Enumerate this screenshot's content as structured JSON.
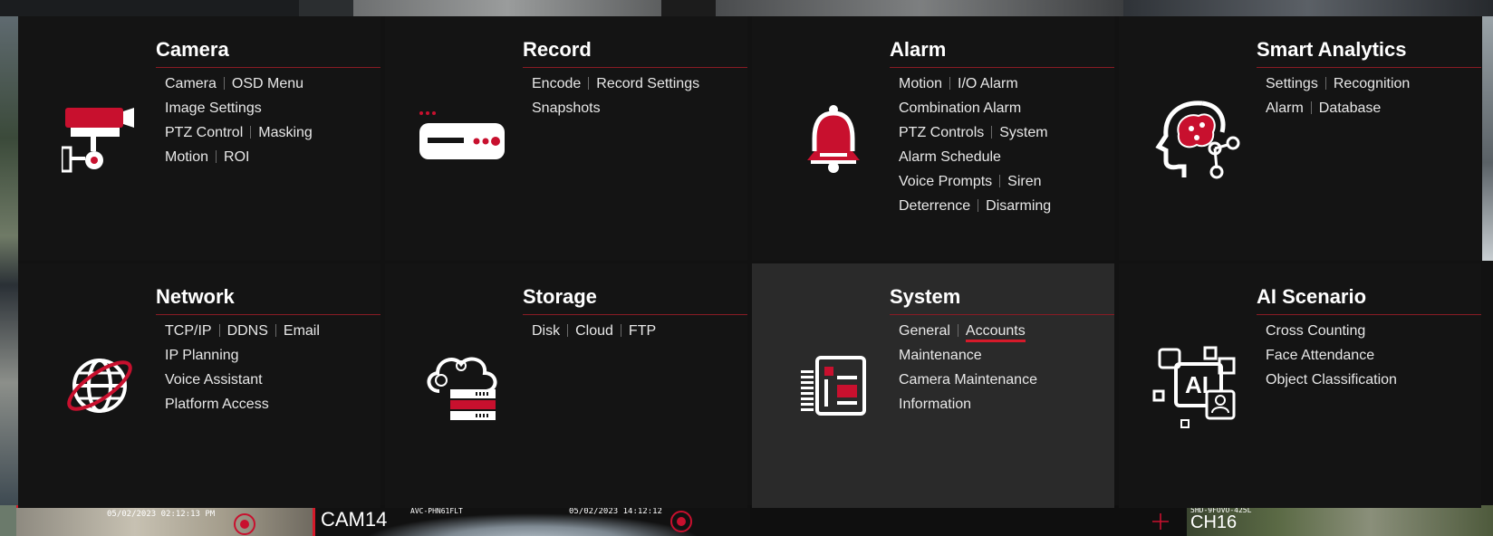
{
  "colors": {
    "accent": "#c8102e",
    "panel": "#141414",
    "panel_active": "#2a2a2a",
    "text": "#ffffff"
  },
  "tiles": [
    {
      "title": "Camera",
      "icon": "camera-icon",
      "rows": [
        [
          "Camera",
          "OSD Menu"
        ],
        [
          "Image Settings"
        ],
        [
          "PTZ Control",
          "Masking"
        ],
        [
          "Motion",
          "ROI"
        ]
      ]
    },
    {
      "title": "Record",
      "icon": "recorder-icon",
      "rows": [
        [
          "Encode",
          "Record Settings"
        ],
        [
          "Snapshots"
        ]
      ]
    },
    {
      "title": "Alarm",
      "icon": "bell-icon",
      "rows": [
        [
          "Motion",
          "I/O Alarm"
        ],
        [
          "Combination Alarm"
        ],
        [
          "PTZ Controls",
          "System"
        ],
        [
          "Alarm Schedule"
        ],
        [
          "Voice Prompts",
          "Siren"
        ],
        [
          "Deterrence",
          "Disarming"
        ]
      ]
    },
    {
      "title": "Smart Analytics",
      "icon": "ai-brain-icon",
      "rows": [
        [
          "Settings",
          "Recognition"
        ],
        [
          "Alarm",
          "Database"
        ]
      ]
    },
    {
      "title": "Network",
      "icon": "globe-icon",
      "rows": [
        [
          "TCP/IP",
          "DDNS",
          "Email"
        ],
        [
          "IP Planning"
        ],
        [
          "Voice Assistant"
        ],
        [
          "Platform Access"
        ]
      ]
    },
    {
      "title": "Storage",
      "icon": "cloud-storage-icon",
      "rows": [
        [
          "Disk",
          "Cloud",
          "FTP"
        ]
      ]
    },
    {
      "title": "System",
      "icon": "system-panel-icon",
      "rows": [
        [
          "General",
          "Accounts"
        ],
        [
          "Maintenance"
        ],
        [
          "Camera Maintenance"
        ],
        [
          "Information"
        ]
      ],
      "selected": "Accounts",
      "active": true
    },
    {
      "title": "AI Scenario",
      "icon": "ai-scenario-icon",
      "rows": [
        [
          "Cross Counting"
        ],
        [
          "Face Attendance"
        ],
        [
          "Object Classification"
        ]
      ]
    }
  ],
  "bottom_feeds": {
    "left_timestamp": "05/02/2023 02:12:13 PM",
    "cam14_label": "CAM14",
    "cam14_model": "AVC-PHN61FLT",
    "cam14_timestamp": "05/02/2023 14:12:12",
    "ch16_label": "CH16",
    "ch16_model": "5HD-9FOVO-425L"
  }
}
